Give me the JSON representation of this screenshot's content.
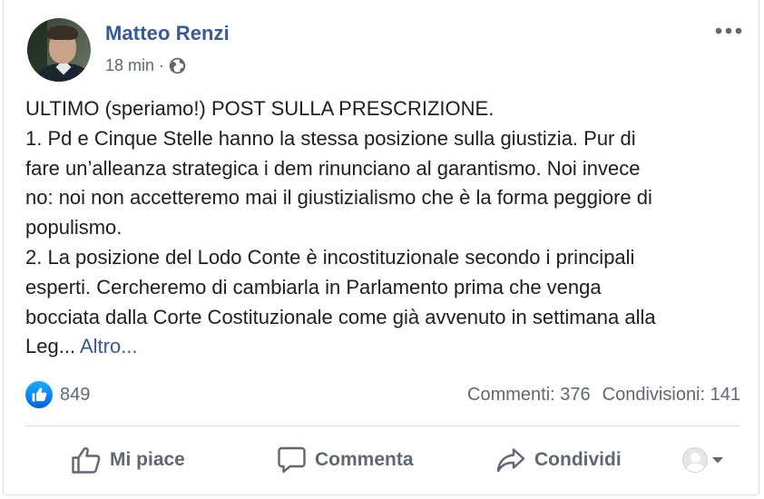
{
  "post": {
    "author": "Matteo Renzi",
    "time": "18 min",
    "separator": "·",
    "privacy_icon": "globe-icon",
    "more_icon": "ellipsis-icon",
    "text_lines": [
      "ULTIMO (speriamo!) POST SULLA PRESCRIZIONE.",
      "1. Pd e Cinque Stelle hanno la stessa posizione sulla giustizia. Pur di",
      "fare un’alleanza strategica i dem rinunciano al garantismo. Noi invece",
      "no: noi non accetteremo mai il giustizialismo che è la forma peggiore di",
      "populismo.",
      "2. La posizione del Lodo Conte è incostituzionale secondo i principali",
      "esperti. Cercheremo di cambiarla in Parlamento prima che venga",
      "bocciata dalla Corte Costituzionale come già avvenuto in settimana alla"
    ],
    "last_line": "Leg...",
    "see_more": "Altro..."
  },
  "stats": {
    "reaction_icon": "like-reaction-icon",
    "likes": "849",
    "comments": "Commenti: 376",
    "shares": "Condivisioni: 141"
  },
  "actions": {
    "like": "Mi piace",
    "comment": "Commenta",
    "share": "Condividi"
  },
  "colors": {
    "author": "#385898",
    "secondary_text": "#606770",
    "like_blue": "#1877f2",
    "divider": "#dadde1"
  }
}
